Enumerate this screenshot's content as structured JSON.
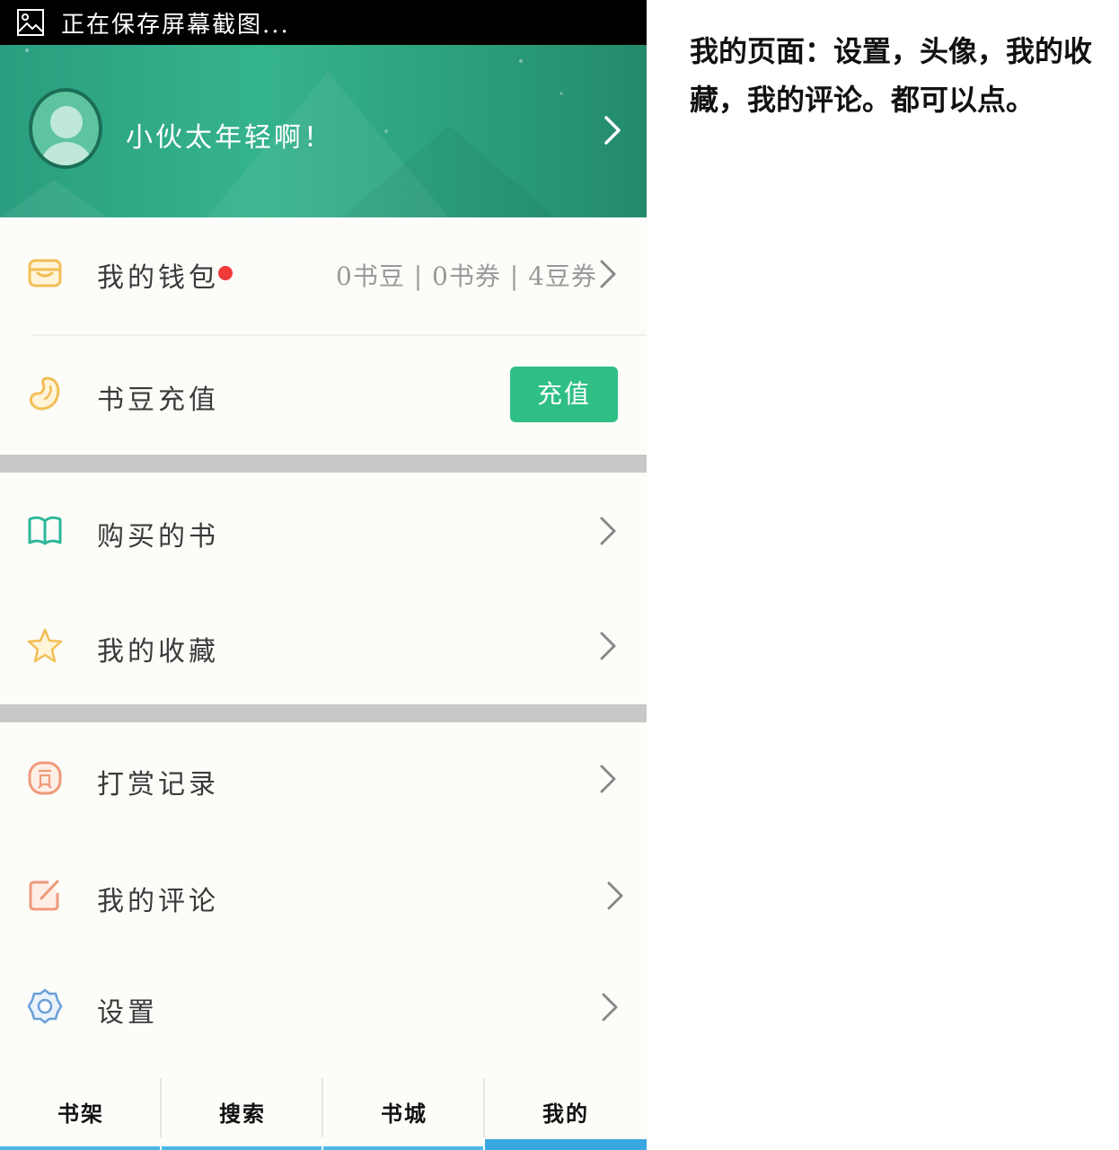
{
  "status_bar": {
    "text": "正在保存屏幕截图...",
    "icon": "image-icon"
  },
  "header": {
    "greeting": "小伙太年轻啊！",
    "accent": "#2fa682"
  },
  "wallet": {
    "label": "我的钱包",
    "info": "0书豆 | 0书券 | 4豆券",
    "badge_color": "#f03a3a"
  },
  "recharge": {
    "label": "书豆充值",
    "button": "充值",
    "button_color": "#2fbf85"
  },
  "menu": {
    "purchased": "购买的书",
    "favorites": "我的收藏",
    "rewards": "打赏记录",
    "comments": "我的评论",
    "settings": "设置"
  },
  "nav": {
    "items": [
      {
        "label": "书架"
      },
      {
        "label": "搜索"
      },
      {
        "label": "书城"
      },
      {
        "label": "我的",
        "active": true
      }
    ]
  },
  "annotation": {
    "text": "我的页面：设置，头像，我的收藏，我的评论。都可以点。"
  }
}
